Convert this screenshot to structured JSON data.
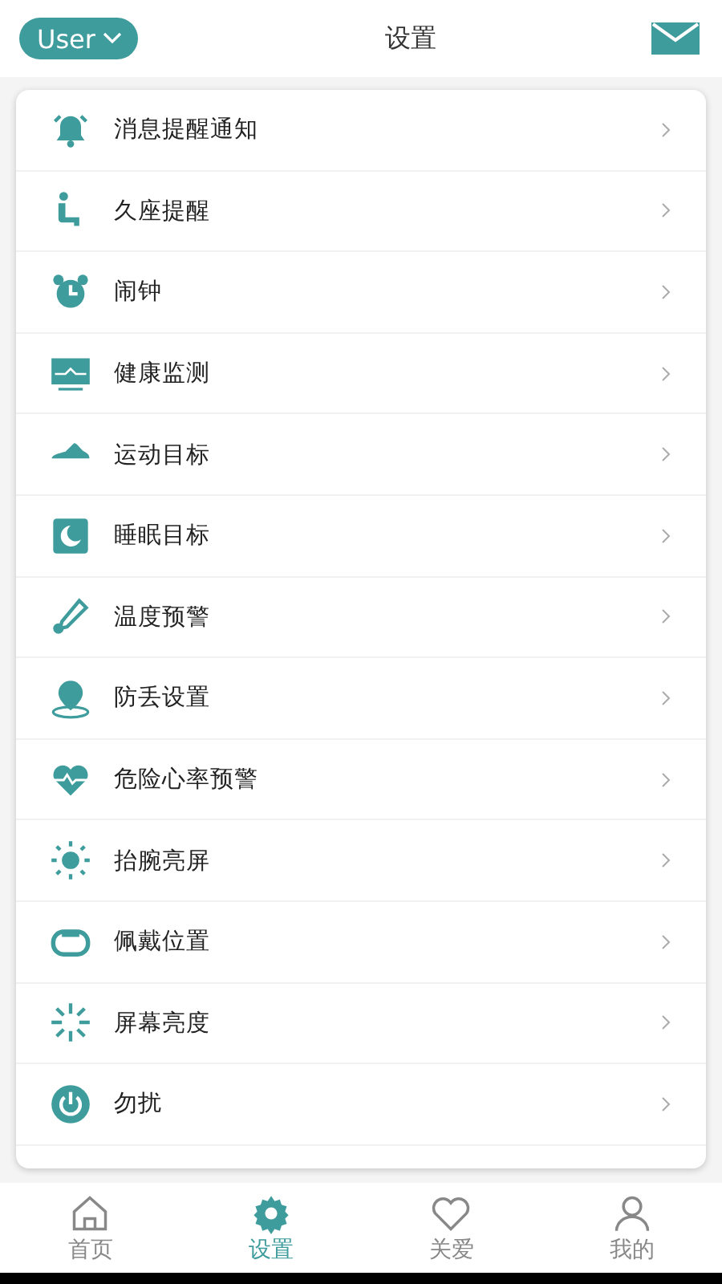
{
  "header": {
    "user_button": "User",
    "title": "设置"
  },
  "settings": [
    {
      "label": "消息提醒通知"
    },
    {
      "label": "久座提醒"
    },
    {
      "label": "闹钟"
    },
    {
      "label": "健康监测"
    },
    {
      "label": "运动目标"
    },
    {
      "label": "睡眠目标"
    },
    {
      "label": "温度预警"
    },
    {
      "label": "防丢设置"
    },
    {
      "label": "危险心率预警"
    },
    {
      "label": "抬腕亮屏"
    },
    {
      "label": "佩戴位置"
    },
    {
      "label": "屏幕亮度"
    },
    {
      "label": "勿扰"
    }
  ],
  "tabs": [
    {
      "label": "首页",
      "selected": false
    },
    {
      "label": "设置",
      "selected": true
    },
    {
      "label": "关爱",
      "selected": false
    },
    {
      "label": "我的",
      "selected": false
    }
  ]
}
